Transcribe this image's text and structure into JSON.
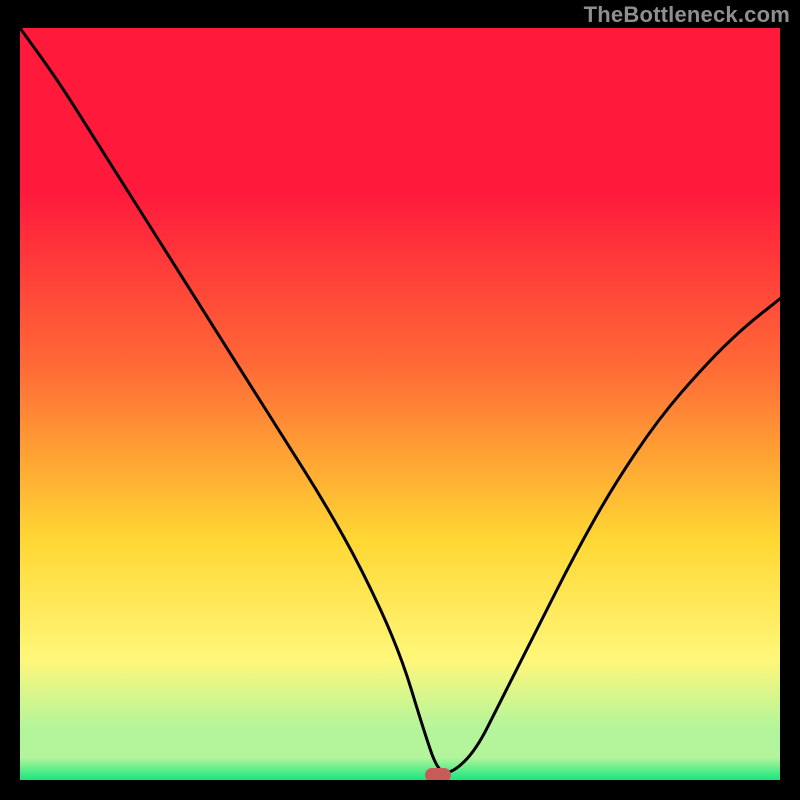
{
  "watermark": "TheBottleneck.com",
  "chart_data": {
    "type": "line",
    "title": "",
    "xlabel": "",
    "ylabel": "",
    "xlim": [
      0,
      100
    ],
    "ylim": [
      0,
      100
    ],
    "legend": false,
    "grid": false,
    "background_gradient": [
      "#ff1a3c",
      "#ff6a36",
      "#ffd733",
      "#fff77a",
      "#b4f59b",
      "#17e67f"
    ],
    "marker": {
      "x": 55,
      "y": 0,
      "color": "#c85a57",
      "shape": "rounded-rect"
    },
    "series": [
      {
        "name": "bottleneck-curve",
        "x": [
          0,
          5,
          10,
          15,
          20,
          25,
          30,
          35,
          40,
          45,
          50,
          53,
          55,
          57,
          60,
          63,
          68,
          73,
          78,
          84,
          90,
          95,
          100
        ],
        "values": [
          100,
          93,
          85,
          77,
          69,
          61,
          53,
          45,
          37,
          28,
          17,
          7,
          1,
          1,
          4,
          10,
          20,
          30,
          39,
          48,
          55,
          60,
          64
        ]
      }
    ]
  }
}
